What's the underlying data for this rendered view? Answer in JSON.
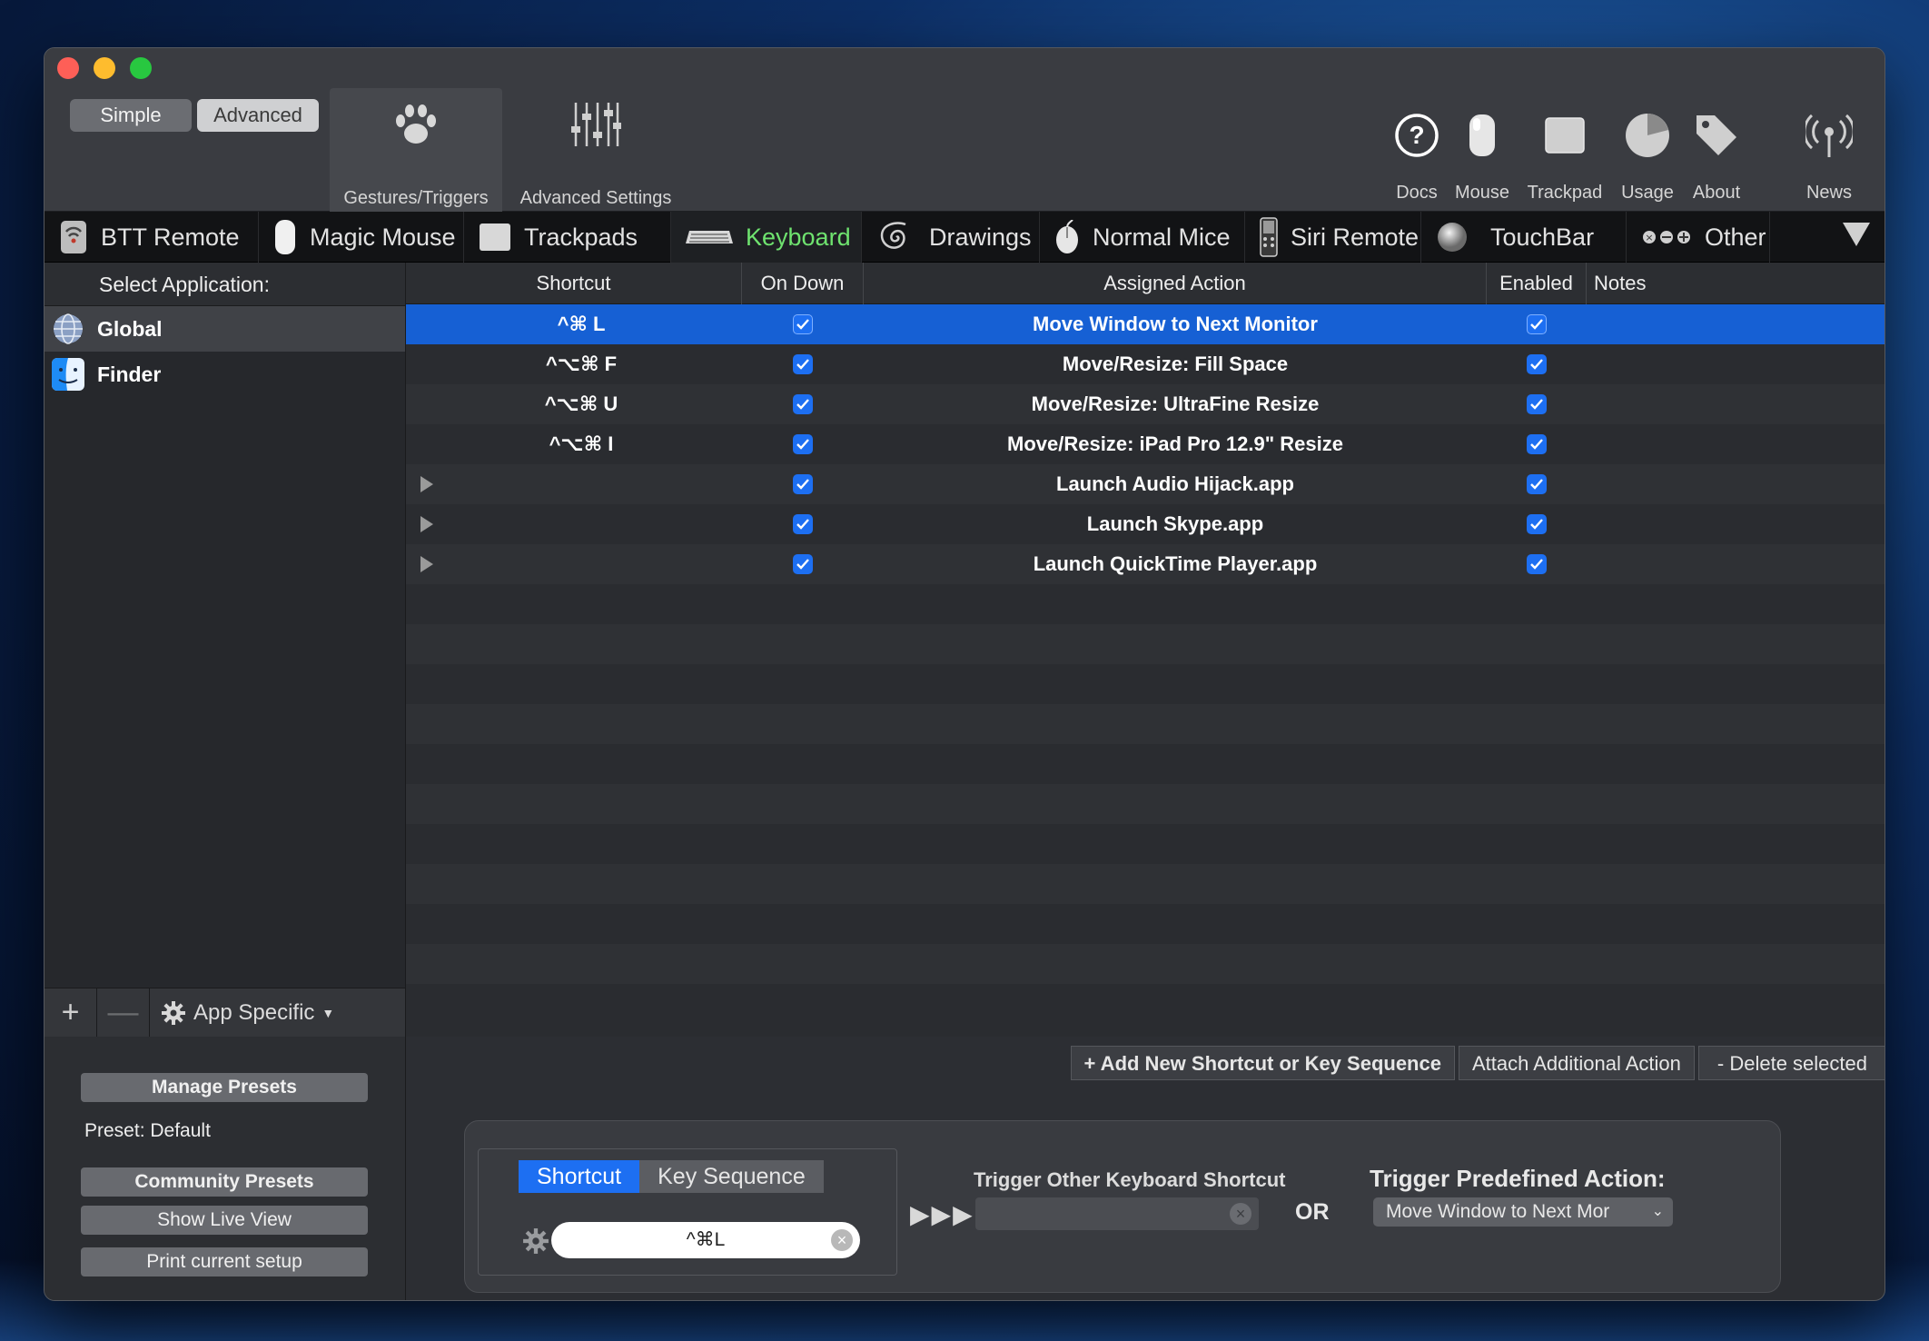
{
  "toolbar": {
    "mode_simple": "Simple",
    "mode_advanced": "Advanced",
    "gestures_label": "Gestures/Triggers",
    "advanced_settings_label": "Advanced Settings",
    "right_items": [
      {
        "label": "Docs",
        "icon": "question-circle-icon"
      },
      {
        "label": "Mouse",
        "icon": "mouse-icon"
      },
      {
        "label": "Trackpad",
        "icon": "trackpad-icon"
      },
      {
        "label": "Usage",
        "icon": "pie-chart-icon"
      },
      {
        "label": "About",
        "icon": "tag-icon"
      },
      {
        "label": "News",
        "icon": "antenna-icon"
      }
    ]
  },
  "tabs": [
    {
      "label": "BTT Remote",
      "icon": "remote-icon"
    },
    {
      "label": "Magic Mouse",
      "icon": "magic-mouse-icon"
    },
    {
      "label": "Trackpads",
      "icon": "trackpad-icon"
    },
    {
      "label": "Keyboard",
      "icon": "keyboard-icon"
    },
    {
      "label": "Drawings",
      "icon": "spiral-icon"
    },
    {
      "label": "Normal Mice",
      "icon": "mouse-icon"
    },
    {
      "label": "Siri Remote",
      "icon": "siri-remote-icon"
    },
    {
      "label": "TouchBar",
      "icon": "touchbar-icon"
    },
    {
      "label": "Other",
      "icon": "dots-icon"
    }
  ],
  "sidebar": {
    "header": "Select Application:",
    "apps": [
      {
        "label": "Global",
        "icon": "globe-icon"
      },
      {
        "label": "Finder",
        "icon": "finder-icon"
      }
    ],
    "footer": {
      "add": "+",
      "remove": "—",
      "app_specific": "App Specific"
    }
  },
  "table": {
    "columns": [
      "Shortcut",
      "On Down",
      "Assigned Action",
      "Enabled",
      "Notes"
    ],
    "rows": [
      {
        "shortcut": "^⌘ L",
        "action": "Move Window to Next Monitor"
      },
      {
        "shortcut": "^⌥⌘ F",
        "action": "Move/Resize: Fill Space"
      },
      {
        "shortcut": "^⌥⌘ U",
        "action": "Move/Resize: UltraFine Resize"
      },
      {
        "shortcut": "^⌥⌘ I",
        "action": "Move/Resize: iPad Pro 12.9\" Resize"
      },
      {
        "shortcut": "",
        "action": "Launch Audio Hijack.app"
      },
      {
        "shortcut": "",
        "action": "Launch Skype.app"
      },
      {
        "shortcut": "",
        "action": "Launch QuickTime Player.app"
      }
    ]
  },
  "actions": {
    "add": "+ Add New Shortcut or Key Sequence",
    "attach": "Attach Additional Action",
    "delete": "- Delete selected"
  },
  "presets": {
    "manage": "Manage Presets",
    "current": "Preset: Default",
    "community": "Community Presets",
    "live_view": "Show Live View",
    "print": "Print current setup"
  },
  "editor": {
    "tab_shortcut": "Shortcut",
    "tab_sequence": "Key Sequence",
    "shortcut_value": "^⌘L",
    "arrows": "▶▶▶",
    "trigger_other_label": "Trigger Other Keyboard Shortcut",
    "or": "OR",
    "predefined_label": "Trigger Predefined Action:",
    "predefined_value": "Move Window to Next Mor"
  }
}
